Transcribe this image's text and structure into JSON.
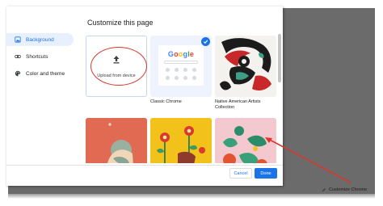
{
  "dialog": {
    "title": "Customize this page",
    "nav": [
      {
        "label": "Background",
        "icon": "image-icon",
        "active": true
      },
      {
        "label": "Shortcuts",
        "icon": "link-icon",
        "active": false
      },
      {
        "label": "Color and theme",
        "icon": "palette-icon",
        "active": false
      }
    ],
    "tiles": {
      "upload_label": "Upload from device",
      "classic_caption": "Classic Chrome",
      "classic_logo": "Google",
      "native_caption": "Native American Artists Collection"
    },
    "buttons": {
      "cancel": "Cancel",
      "done": "Done"
    }
  },
  "page": {
    "customize_link": "Customize Chrome"
  },
  "colors": {
    "accent": "#1a73e8",
    "annotation": "#d9372b",
    "backdrop": "#6b6b6b"
  }
}
